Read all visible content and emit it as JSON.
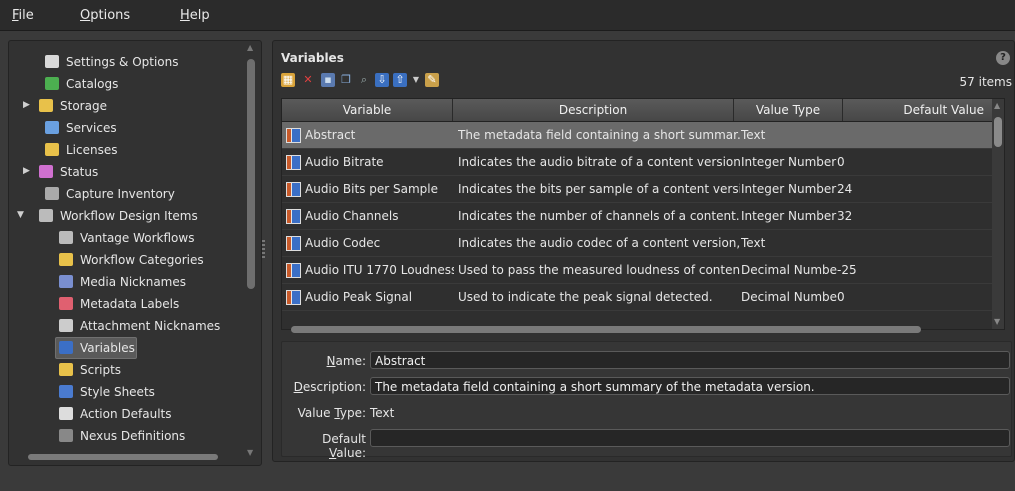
{
  "menu": {
    "file": "File",
    "options": "Options",
    "help": "Help"
  },
  "tree": {
    "items": [
      {
        "label": "Settings & Options",
        "icon": "settings-icon",
        "color": "#d9d9d9"
      },
      {
        "label": "Catalogs",
        "icon": "catalogs-icon",
        "color": "#4caf50"
      },
      {
        "label": "Storage",
        "icon": "folder-icon",
        "color": "#e8c14a"
      },
      {
        "label": "Services",
        "icon": "services-icon",
        "color": "#6aa0e0"
      },
      {
        "label": "Licenses",
        "icon": "key-icon",
        "color": "#e8c14a"
      },
      {
        "label": "Status",
        "icon": "status-chart-icon",
        "color": "#d070d0"
      },
      {
        "label": "Capture Inventory",
        "icon": "capture-icon",
        "color": "#aaaaaa"
      },
      {
        "label": "Workflow Design Items",
        "icon": "workflow-icon",
        "color": "#bbbbbb"
      },
      {
        "label": "Vantage Workflows",
        "icon": "workflow-icon",
        "color": "#bbbbbb"
      },
      {
        "label": "Workflow Categories",
        "icon": "folder-icon",
        "color": "#e8c14a"
      },
      {
        "label": "Media Nicknames",
        "icon": "media-icon",
        "color": "#7a8fd0"
      },
      {
        "label": "Metadata Labels",
        "icon": "metadata-icon",
        "color": "#e06070"
      },
      {
        "label": "Attachment Nicknames",
        "icon": "paperclip-icon",
        "color": "#cccccc"
      },
      {
        "label": "Variables",
        "icon": "variables-icon",
        "color": "#3b6fc6"
      },
      {
        "label": "Scripts",
        "icon": "scripts-icon",
        "color": "#e8c14a"
      },
      {
        "label": "Style Sheets",
        "icon": "stylesheet-icon",
        "color": "#4a7bd0"
      },
      {
        "label": "Action Defaults",
        "icon": "action-defaults-icon",
        "color": "#dddddd"
      },
      {
        "label": "Nexus Definitions",
        "icon": "nexus-icon",
        "color": "#888888"
      }
    ]
  },
  "main": {
    "title": "Variables",
    "help": "?",
    "items_count": "57 items",
    "columns": [
      "Variable",
      "Description",
      "Value Type",
      "Default Value"
    ],
    "rows": [
      {
        "variable": "Abstract",
        "description": "The metadata field containing a short summar...",
        "type": "Text",
        "default": ""
      },
      {
        "variable": "Audio Bitrate",
        "description": "Indicates the audio bitrate of a content version...",
        "type": "Integer Number",
        "default": "0"
      },
      {
        "variable": "Audio Bits per Sample",
        "description": "Indicates the bits per sample of a content versi...",
        "type": "Integer Number",
        "default": "24"
      },
      {
        "variable": "Audio Channels",
        "description": "Indicates the number of channels of a content...",
        "type": "Integer Number",
        "default": "32"
      },
      {
        "variable": "Audio Codec",
        "description": "Indicates the audio codec of a content version,...",
        "type": "Text",
        "default": ""
      },
      {
        "variable": "Audio ITU 1770 Loudness",
        "description": "Used to pass the measured loudness of conten...",
        "type": "Decimal Number",
        "default": "-25"
      },
      {
        "variable": "Audio Peak Signal",
        "description": "Used to indicate the peak signal detected.",
        "type": "Decimal Number",
        "default": "0"
      }
    ]
  },
  "details": {
    "name_label": "Name:",
    "name_value": "Abstract",
    "description_label": "Description:",
    "description_value": "The metadata field containing a short summary of the metadata version.",
    "value_type_label": "Value Type:",
    "value_type_value": "Text",
    "default_value_label": "Default Value:",
    "default_value_value": ""
  }
}
